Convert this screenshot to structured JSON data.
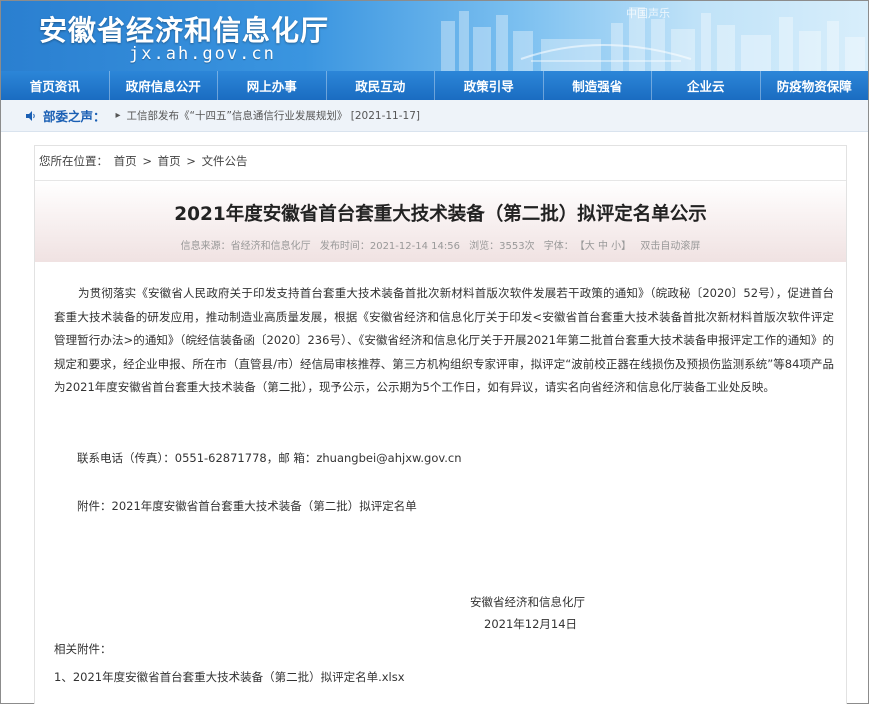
{
  "header": {
    "site_title": "安徽省经济和信息化厅",
    "site_domain": "jx.ah.gov.cn",
    "banner_watermark": "中国声乐"
  },
  "nav": {
    "items": [
      "首页资讯",
      "政府信息公开",
      "网上办事",
      "政民互动",
      "政策引导",
      "制造强省",
      "企业云",
      "防疫物资保障"
    ]
  },
  "ticker": {
    "label": "部委之声：",
    "text": "工信部发布《“十四五”信息通信行业发展规划》 [2021-11-17]"
  },
  "breadcrumb": {
    "prefix": "您所在位置：",
    "items": [
      "首页",
      "首页",
      "文件公告"
    ],
    "separator": ">"
  },
  "article": {
    "title": "2021年度安徽省首台套重大技术装备（第二批）拟评定名单公示",
    "meta": {
      "source": "信息来源：省经济和信息化厅",
      "publish_time": "发布时间：2021-12-14 14:56",
      "views": "浏览：3553次",
      "font_label": "字体：",
      "font_sizes": "【大 中 小】",
      "auto_scroll": "双击自动滚屏"
    },
    "body": "为贯彻落实《安徽省人民政府关于印发支持首台套重大技术装备首批次新材料首版次软件发展若干政策的通知》（皖政秘〔2020〕52号），促进首台套重大技术装备的研发应用，推动制造业高质量发展，根据《安徽省经济和信息化厅关于印发<安徽省首台套重大技术装备首批次新材料首版次软件评定管理暂行办法>的通知》（皖经信装备函〔2020〕236号）、《安徽省经济和信息化厅关于开展2021年第二批首台套重大技术装备申报评定工作的通知》的规定和要求，经企业申报、所在市（直管县/市）经信局审核推荐、第三方机构组织专家评审，拟评定“波前校正器在线损伤及预损伤监测系统”等84项产品为2021年度安徽省首台套重大技术装备（第二批），现予公示，公示期为5个工作日，如有异议，请实名向省经济和信息化厅装备工业处反映。",
    "contact": "联系电话（传真）：0551-62871778，邮 箱：zhuangbei@ahjxw.gov.cn",
    "attachment": "附件：2021年度安徽省首台套重大技术装备（第二批）拟评定名单",
    "signature_org": "安徽省经济和信息化厅",
    "signature_date": "2021年12月14日"
  },
  "related": {
    "label": "相关附件：",
    "files": [
      "1、2021年度安徽省首台套重大技术装备（第二批）拟评定名单.xlsx"
    ]
  }
}
